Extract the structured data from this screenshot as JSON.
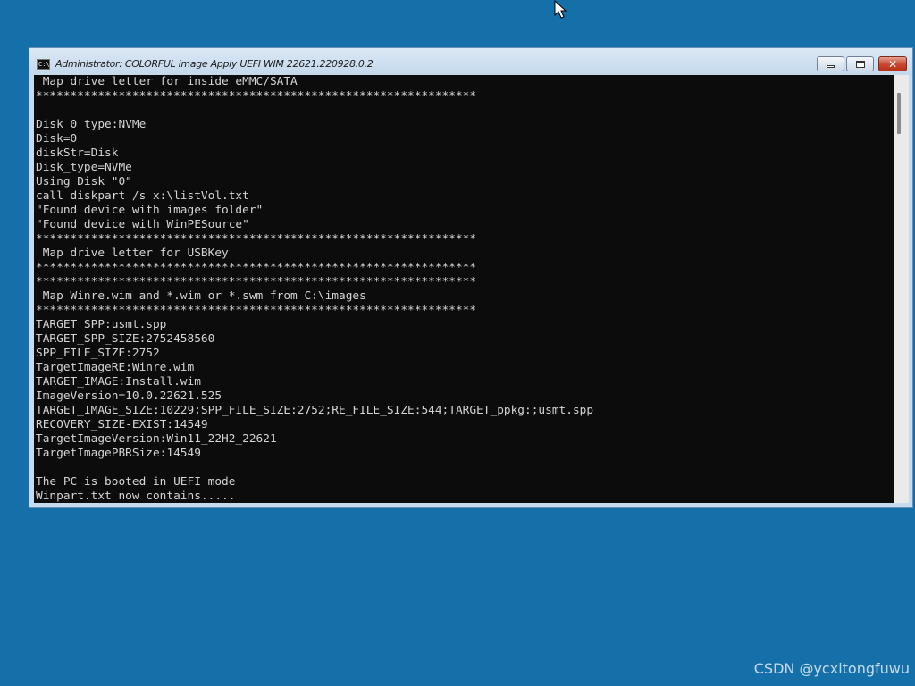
{
  "window": {
    "title": "Administrator:  COLORFUL image Apply UEFI WIM 22621.220928.0.2",
    "icon_label": "C:\\",
    "controls": {
      "minimize": "minimize-icon",
      "maximize": "maximize-icon",
      "close": "close-icon",
      "close_glyph": "✕"
    }
  },
  "console": {
    "lines": [
      " Map drive letter for inside eMMC/SATA",
      "****************************************************************",
      "",
      "Disk 0 type:NVMe",
      "Disk=0",
      "diskStr=Disk",
      "Disk_type=NVMe",
      "Using Disk \"0\"",
      "call diskpart /s x:\\listVol.txt",
      "\"Found device with images folder\"",
      "\"Found device with WinPESource\"",
      "****************************************************************",
      " Map drive letter for USBKey",
      "****************************************************************",
      "****************************************************************",
      " Map Winre.wim and *.wim or *.swm from C:\\images",
      "****************************************************************",
      "TARGET_SPP:usmt.spp",
      "TARGET_SPP_SIZE:2752458560",
      "SPP_FILE_SIZE:2752",
      "TargetImageRE:Winre.wim",
      "TARGET_IMAGE:Install.wim",
      "ImageVersion=10.0.22621.525",
      "TARGET_IMAGE_SIZE:10229;SPP_FILE_SIZE:2752;RE_FILE_SIZE:544;TARGET_ppkg:;usmt.spp",
      "RECOVERY_SIZE-EXIST:14549",
      "TargetImageVersion:Win11_22H2_22621",
      "TargetImagePBRSize:14549",
      "",
      "The PC is booted in UEFI mode",
      "Winpart.txt now contains....."
    ]
  },
  "watermark": "CSDN @ycxitongfuwu",
  "colors": {
    "desktop": "#1570a9",
    "console_bg": "#0c0c0c",
    "console_text": "#d4d4d4",
    "close_button": "#c9452d"
  }
}
